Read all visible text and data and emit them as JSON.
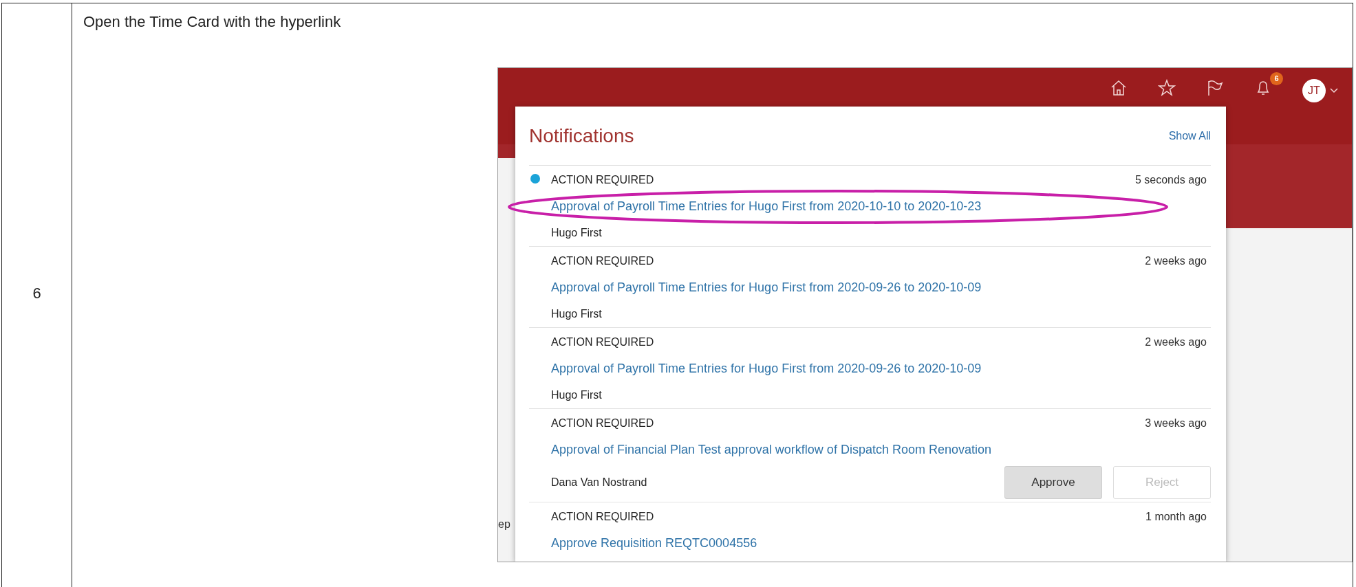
{
  "step": {
    "number": "6",
    "instruction": "Open the Time Card with the hyperlink"
  },
  "app": {
    "header": {
      "badge": "6",
      "avatar": "JT"
    },
    "background_text": "ep",
    "notifications": {
      "title": "Notifications",
      "show_all": "Show All",
      "items": [
        {
          "label": "ACTION REQUIRED",
          "time": "5 seconds ago",
          "link": "Approval of Payroll Time Entries for Hugo First from 2020-10-10 to 2020-10-23",
          "from": "Hugo First",
          "unread": true,
          "highlighted": true
        },
        {
          "label": "ACTION REQUIRED",
          "time": "2 weeks ago",
          "link": "Approval of Payroll Time Entries for Hugo First from 2020-09-26 to 2020-10-09",
          "from": "Hugo First",
          "unread": false,
          "highlighted": false
        },
        {
          "label": "ACTION REQUIRED",
          "time": "2 weeks ago",
          "link": "Approval of Payroll Time Entries for Hugo First from 2020-09-26 to 2020-10-09",
          "from": "Hugo First",
          "unread": false,
          "highlighted": false
        },
        {
          "label": "ACTION REQUIRED",
          "time": "3 weeks ago",
          "link": "Approval of Financial Plan Test approval workflow of Dispatch Room Renovation",
          "from": "Dana Van Nostrand",
          "unread": false,
          "highlighted": false,
          "actions": [
            {
              "label": "Approve",
              "disabled": false
            },
            {
              "label": "Reject",
              "disabled": true
            }
          ]
        },
        {
          "label": "ACTION REQUIRED",
          "time": "1 month ago",
          "link": "Approve Requisition REQTC0004556",
          "unread": false,
          "highlighted": false
        }
      ]
    }
  }
}
